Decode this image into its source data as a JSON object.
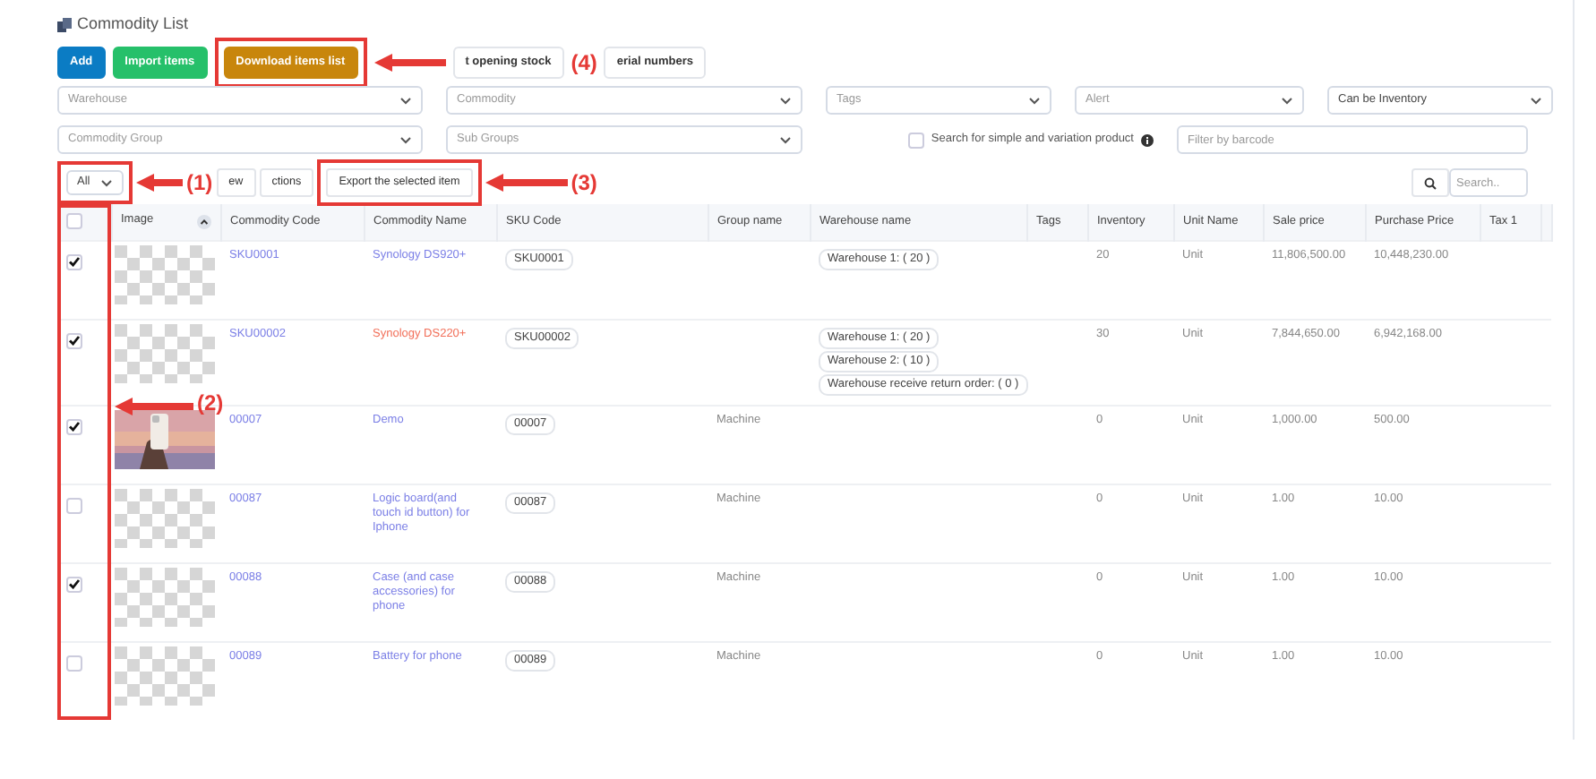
{
  "title": "Commodity List",
  "actions": [
    {
      "label": "Add",
      "kind": "primary"
    },
    {
      "label": "Import items",
      "kind": "success"
    },
    {
      "label": "Download items list",
      "kind": "warning"
    },
    {
      "label": "t opening stock",
      "kind": "plain"
    },
    {
      "label": "erial numbers",
      "kind": "plain"
    }
  ],
  "filters_row_1": [
    {
      "placeholder": "Warehouse"
    },
    {
      "placeholder": "Commodity"
    },
    {
      "placeholder": "Tags"
    },
    {
      "placeholder": "Alert"
    },
    {
      "value": "Can be Inventory"
    }
  ],
  "filters_row_2": [
    {
      "placeholder": "Commodity Group"
    },
    {
      "placeholder": "Sub Groups"
    }
  ],
  "variation_search": {
    "label": "Search for simple and variation product",
    "checked": false
  },
  "barcode": {
    "placeholder": "Filter by barcode"
  },
  "toolbar": {
    "page_length": "All",
    "buttons": [
      "ew",
      "ctions",
      "Export the selected item"
    ],
    "search_placeholder": "Search.."
  },
  "table": {
    "columns": [
      "Image",
      "Commodity Code",
      "Commodity Name",
      "SKU Code",
      "Group name",
      "Warehouse name",
      "Tags",
      "Inventory",
      "Unit Name",
      "Sale price",
      "Purchase Price",
      "Tax 1"
    ],
    "header_selected": false,
    "rows": [
      {
        "selected": true,
        "kind": "placeholder",
        "code": "SKU0001",
        "name": "Synology DS920+",
        "color": "#7b7fe6",
        "sku": "SKU0001",
        "group": "",
        "warehouses": [
          "Warehouse 1: ( 20 )"
        ],
        "inventory": "20",
        "unit": "Unit",
        "sale_price": "11,806,500.00",
        "purchase_price": "10,448,230.00"
      },
      {
        "selected": true,
        "kind": "placeholder",
        "code": "SKU00002",
        "name": "Synology DS220+",
        "color": "#f2705a",
        "sku": "SKU00002",
        "group": "",
        "warehouses": [
          "Warehouse 1: ( 20 )",
          "Warehouse 2: ( 10 )",
          "Warehouse receive return order: ( 0 )"
        ],
        "inventory": "30",
        "unit": "Unit",
        "sale_price": "7,844,650.00",
        "purchase_price": "6,942,168.00"
      },
      {
        "selected": true,
        "kind": "picture",
        "code": "00007",
        "name": "Demo",
        "color": "#7b7fe6",
        "sku": "00007",
        "group": "Machine",
        "warehouses": [],
        "inventory": "0",
        "unit": "Unit",
        "sale_price": "1,000.00",
        "purchase_price": "500.00"
      },
      {
        "selected": false,
        "kind": "placeholder",
        "code": "00087",
        "name": "Logic board(and touch id button) for Iphone",
        "color": "#7b7fe6",
        "sku": "00087",
        "group": "Machine",
        "warehouses": [],
        "inventory": "0",
        "unit": "Unit",
        "sale_price": "1.00",
        "purchase_price": "10.00"
      },
      {
        "selected": true,
        "kind": "placeholder",
        "code": "00088",
        "name": "Case (and case accessories) for phone",
        "color": "#7b7fe6",
        "sku": "00088",
        "group": "Machine",
        "warehouses": [],
        "inventory": "0",
        "unit": "Unit",
        "sale_price": "1.00",
        "purchase_price": "10.00"
      },
      {
        "selected": false,
        "kind": "placeholder",
        "code": "00089",
        "name": "Battery for phone",
        "color": "#7b7fe6",
        "sku": "00089",
        "group": "Machine",
        "warehouses": [],
        "inventory": "0",
        "unit": "Unit",
        "sale_price": "1.00",
        "purchase_price": "10.00"
      }
    ]
  },
  "annotations": [
    "(4)",
    "(1)",
    "(3)",
    "(2)"
  ]
}
